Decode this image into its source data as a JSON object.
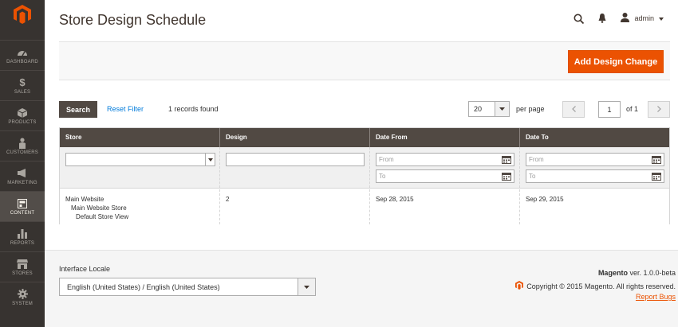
{
  "colors": {
    "sidebar": "#373330",
    "accent": "#eb5202",
    "grid_header": "#514943",
    "link": "#007bdb"
  },
  "sidebar": {
    "logo_icon": "magento-logo-icon",
    "items": [
      {
        "label": "DASHBOARD",
        "icon": "speedometer-icon"
      },
      {
        "label": "SALES",
        "icon": "dollar-icon"
      },
      {
        "label": "PRODUCTS",
        "icon": "cube-icon"
      },
      {
        "label": "CUSTOMERS",
        "icon": "person-icon"
      },
      {
        "label": "MARKETING",
        "icon": "megaphone-icon"
      },
      {
        "label": "CONTENT",
        "icon": "layout-icon",
        "active": true
      },
      {
        "label": "REPORTS",
        "icon": "bar-chart-icon"
      },
      {
        "label": "STORES",
        "icon": "storefront-icon"
      },
      {
        "label": "SYSTEM",
        "icon": "gear-icon"
      }
    ]
  },
  "header": {
    "title": "Store Design Schedule",
    "user": "admin"
  },
  "actions": {
    "add_label": "Add Design Change"
  },
  "toolbar": {
    "search_label": "Search",
    "reset_label": "Reset Filter",
    "records_text": "1 records found",
    "per_page_value": "20",
    "per_page_label": "per page",
    "page_current": "1",
    "page_of": "of 1"
  },
  "grid": {
    "columns": [
      "Store",
      "Design",
      "Date From",
      "Date To"
    ],
    "filters": {
      "from_placeholder": "From",
      "to_placeholder": "To"
    },
    "rows": [
      {
        "store": [
          "Main Website",
          "Main Website Store",
          "Default Store View"
        ],
        "design": "2",
        "date_from": "Sep 28, 2015",
        "date_to": "Sep 29, 2015"
      }
    ]
  },
  "footer": {
    "locale_label": "Interface Locale",
    "locale_value": "English (United States) / English (United States)",
    "brand": "Magento",
    "version": "ver. 1.0.0-beta",
    "copyright": "Copyright © 2015 Magento. All rights reserved.",
    "report_bugs": "Report Bugs"
  }
}
